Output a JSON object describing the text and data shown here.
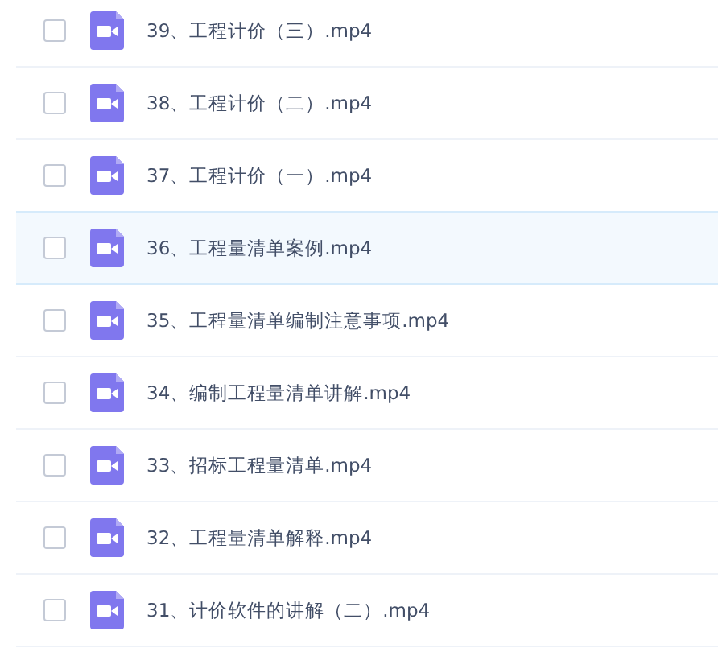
{
  "files": [
    {
      "name": "39、工程计价（三）.mp4",
      "checked": false,
      "highlighted": false
    },
    {
      "name": "38、工程计价（二）.mp4",
      "checked": false,
      "highlighted": false
    },
    {
      "name": "37、工程计价（一）.mp4",
      "checked": false,
      "highlighted": false
    },
    {
      "name": "36、工程量清单案例.mp4",
      "checked": false,
      "highlighted": true
    },
    {
      "name": "35、工程量清单编制注意事项.mp4",
      "checked": false,
      "highlighted": false
    },
    {
      "name": "34、编制工程量清单讲解.mp4",
      "checked": false,
      "highlighted": false
    },
    {
      "name": "33、招标工程量清单.mp4",
      "checked": false,
      "highlighted": false
    },
    {
      "name": "32、工程量清单解释.mp4",
      "checked": false,
      "highlighted": false
    },
    {
      "name": "31、计价软件的讲解（二）.mp4",
      "checked": false,
      "highlighted": false
    }
  ]
}
